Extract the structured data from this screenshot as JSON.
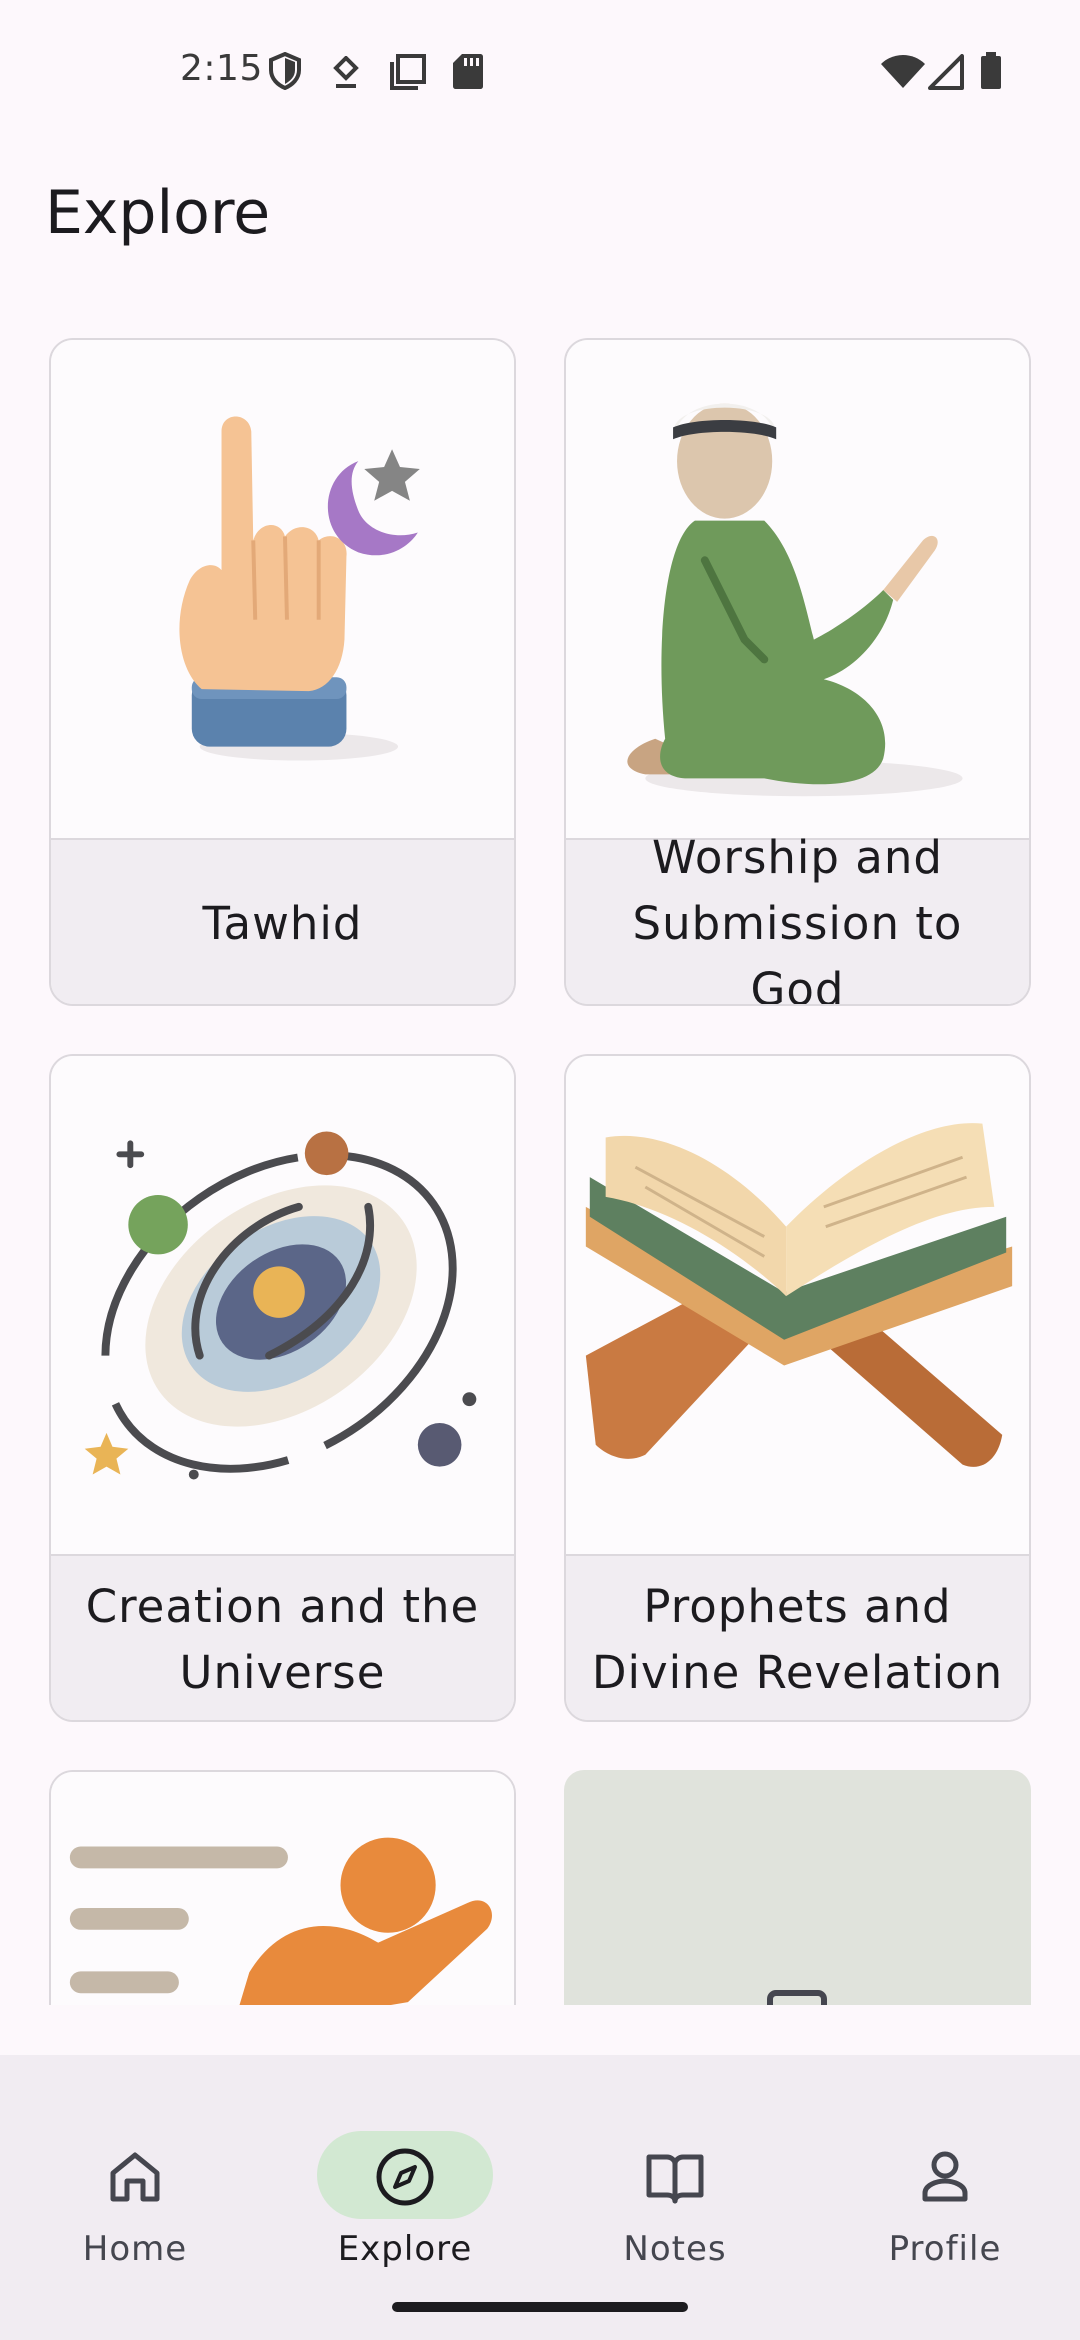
{
  "status_bar": {
    "time": "2:15",
    "left_icons": [
      "shield-icon",
      "download-arrow-icon",
      "screenshot-icon",
      "sd-card-icon"
    ],
    "right_icons": [
      "wifi-icon",
      "cell-signal-icon",
      "battery-icon"
    ]
  },
  "header": {
    "title": "Explore"
  },
  "topics": [
    {
      "label": "Tawhid",
      "icon": "pointing-hand-crescent-illustration"
    },
    {
      "label": "Worship and Submission to God",
      "icon": "praying-man-illustration"
    },
    {
      "label": "Creation and the Universe",
      "icon": "galaxy-illustration"
    },
    {
      "label": "Prophets and Divine Revelation",
      "icon": "quran-on-stand-illustration"
    },
    {
      "label": "",
      "icon": "running-figure-illustration"
    },
    {
      "label": "",
      "icon": "image-placeholder-icon"
    }
  ],
  "bottom_nav": {
    "items": [
      {
        "label": "Home",
        "icon": "home-icon",
        "active": false
      },
      {
        "label": "Explore",
        "icon": "compass-icon",
        "active": true
      },
      {
        "label": "Notes",
        "icon": "book-icon",
        "active": false
      },
      {
        "label": "Profile",
        "icon": "person-icon",
        "active": false
      }
    ]
  },
  "colors": {
    "background": "#fdf8fc",
    "nav_active_pill": "#d2e8d2",
    "card_label_bg": "#f1edf2",
    "placeholder_bg": "#e0e3dc"
  }
}
